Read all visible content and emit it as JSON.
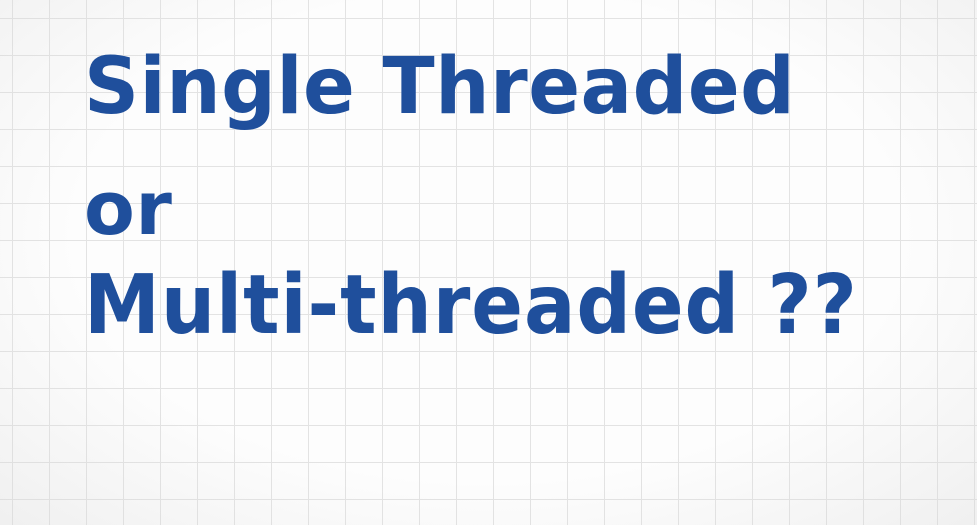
{
  "slide": {
    "lines": [
      "Single Threaded",
      "or",
      "Multi-threaded ??"
    ],
    "text_color": "#1f4f9c",
    "background_color": "#fdfdfd",
    "grid_color": "#e3e3e3"
  }
}
